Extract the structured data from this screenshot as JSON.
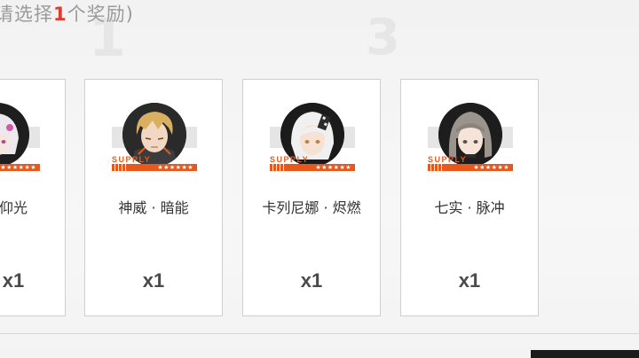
{
  "header": {
    "prefix": "请选择",
    "count": "1",
    "suffix": "个奖励)"
  },
  "supply_label": "SUPPLY",
  "rarity_stars": "★★★★★★",
  "rewards": [
    {
      "name": "仰光",
      "quantity": "x1",
      "hair_color": "#e8e4ea",
      "accent_color": "#d05aa8"
    },
    {
      "name": "神威 · 暗能",
      "quantity": "x1",
      "hair_color": "#d8b060",
      "accent_color": "#3a3a3a"
    },
    {
      "name": "卡列尼娜 · 烬燃",
      "quantity": "x1",
      "hair_color": "#eeeeee",
      "accent_color": "#2b2b2b"
    },
    {
      "name": "七实 · 脉冲",
      "quantity": "x1",
      "hair_color": "#9a948c",
      "accent_color": "#2b2b2b"
    }
  ],
  "colors": {
    "supply_orange": "#e8581c",
    "highlight_red": "#e23b2e"
  }
}
